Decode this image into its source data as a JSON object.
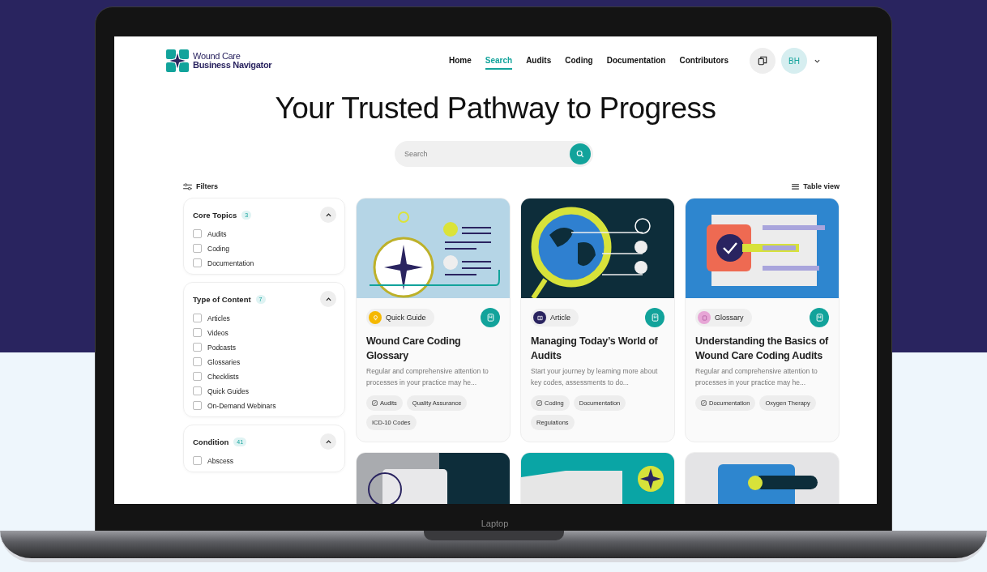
{
  "device_label": "Laptop",
  "brand": {
    "line_1": "Wound Care",
    "line_2": "Business Navigator"
  },
  "nav": [
    {
      "label": "Home",
      "selected": false
    },
    {
      "label": "Search",
      "selected": true
    },
    {
      "label": "Audits",
      "selected": false
    },
    {
      "label": "Coding",
      "selected": false
    },
    {
      "label": "Documentation",
      "selected": false
    },
    {
      "label": "Contributors",
      "selected": false
    }
  ],
  "user": {
    "initials": "BH"
  },
  "hero_title": "Your Trusted Pathway to Progress",
  "search": {
    "placeholder": "Search"
  },
  "filters_label": "Filters",
  "view_label": "Table view",
  "filter_groups": [
    {
      "title": "Core Topics",
      "count": "3",
      "expanded": true,
      "options": [
        {
          "label": "Audits",
          "checked": false
        },
        {
          "label": "Coding",
          "checked": false
        },
        {
          "label": "Documentation",
          "checked": false
        }
      ]
    },
    {
      "title": "Type of Content",
      "count": "7",
      "expanded": true,
      "options": [
        {
          "label": "Articles",
          "checked": false
        },
        {
          "label": "Videos",
          "checked": false
        },
        {
          "label": "Podcasts",
          "checked": false
        },
        {
          "label": "Glossaries",
          "checked": false
        },
        {
          "label": "Checklists",
          "checked": false
        },
        {
          "label": "Quick Guides",
          "checked": false
        },
        {
          "label": "On-Demand Webinars",
          "checked": false
        }
      ]
    },
    {
      "title": "Condition",
      "count": "41",
      "expanded": true,
      "options": [
        {
          "label": "Abscess",
          "checked": false
        }
      ]
    }
  ],
  "cards": [
    {
      "kind": "compass",
      "type": {
        "kind": "guide",
        "label": "Quick Guide",
        "color": "#f5b800"
      },
      "title": "Wound Care Coding Glossary",
      "summary": "Regular and comprehensive attention to processes in your practice may he...",
      "tags": [
        {
          "label": "Audits",
          "has_icon": true
        },
        {
          "label": "Quality Assurance",
          "has_icon": false
        },
        {
          "label": "ICD-10 Codes",
          "has_icon": false
        }
      ]
    },
    {
      "kind": "globe",
      "type": {
        "kind": "article",
        "label": "Article",
        "color": "#2a2460"
      },
      "title": "Managing Today’s World of Audits",
      "summary": "Start your journey by learning more about key codes, assessments to do...",
      "tags": [
        {
          "label": "Coding",
          "has_icon": true
        },
        {
          "label": "Documentation",
          "has_icon": false
        },
        {
          "label": "Regulations",
          "has_icon": false
        }
      ]
    },
    {
      "kind": "checklist",
      "type": {
        "kind": "glossary",
        "label": "Glossary",
        "color": "#e7a6d6"
      },
      "title": "Understanding the Basics of Wound Care Coding Audits",
      "summary": "Regular and comprehensive attention to processes in your practice may he...",
      "tags": [
        {
          "label": "Documentation",
          "has_icon": true
        },
        {
          "label": "Oxygen Therapy",
          "has_icon": false
        }
      ]
    },
    {
      "kind": "panels"
    },
    {
      "kind": "star"
    },
    {
      "kind": "slider"
    }
  ]
}
